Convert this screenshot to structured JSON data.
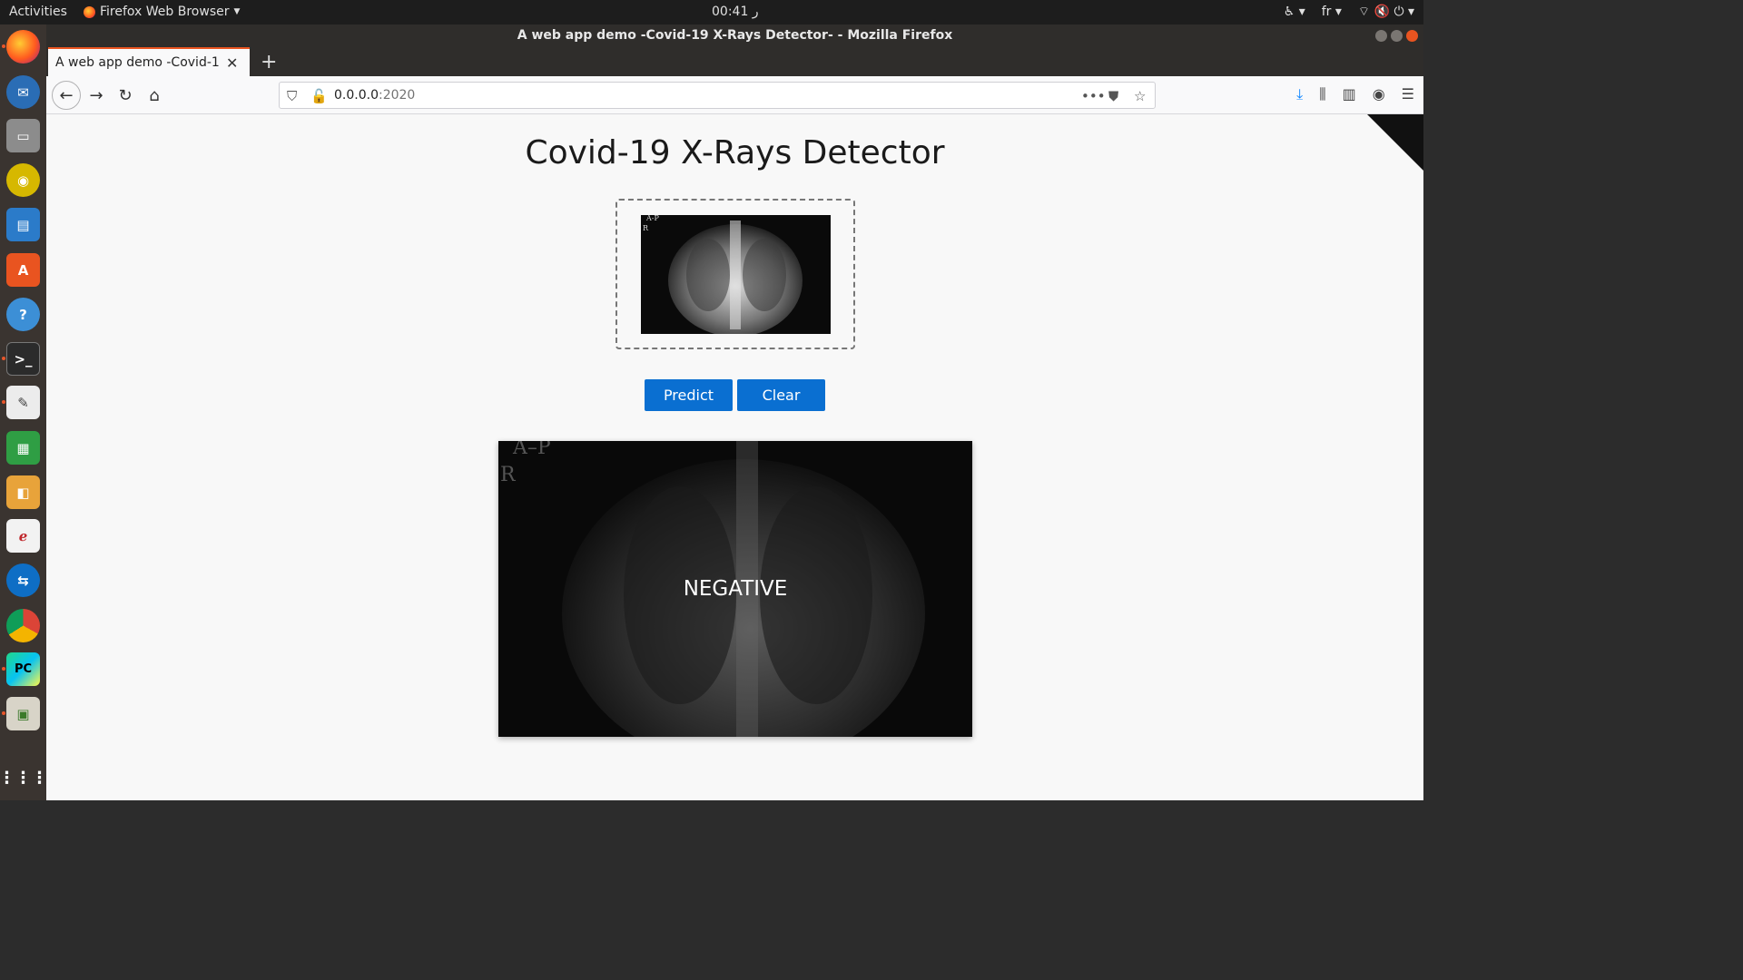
{
  "topbar": {
    "activities": "Activities",
    "app_menu": "Firefox Web Browser",
    "clock": "00:41 ر",
    "language": "fr"
  },
  "window": {
    "title": "A web app demo -Covid-19 X-Rays Detector- - Mozilla Firefox"
  },
  "tab": {
    "title": "A web app demo -Covid-19 X"
  },
  "url": {
    "host": "0.0.0.0",
    "port": ":2020"
  },
  "page": {
    "title": "Covid-19 X-Rays Detector",
    "predict_label": "Predict",
    "clear_label": "Clear",
    "result": "NEGATIVE",
    "thumb_marker_top": "A-P",
    "thumb_marker_side": "R",
    "result_marker_top": "A–P",
    "result_marker_side": "R"
  },
  "colors": {
    "accent": "#0a6fd1",
    "ubuntu_orange": "#e95420",
    "dock": "#3a3430"
  },
  "dock_icons": [
    "firefox-icon",
    "thunderbird-icon",
    "files-icon",
    "rhythmbox-icon",
    "writer-icon",
    "software-icon",
    "help-icon",
    "terminal-icon",
    "text-editor-icon",
    "calc-icon",
    "impress-icon",
    "document-viewer-icon",
    "teamviewer-icon",
    "chrome-icon",
    "pycharm-icon",
    "image-viewer-icon",
    "show-apps-icon"
  ]
}
